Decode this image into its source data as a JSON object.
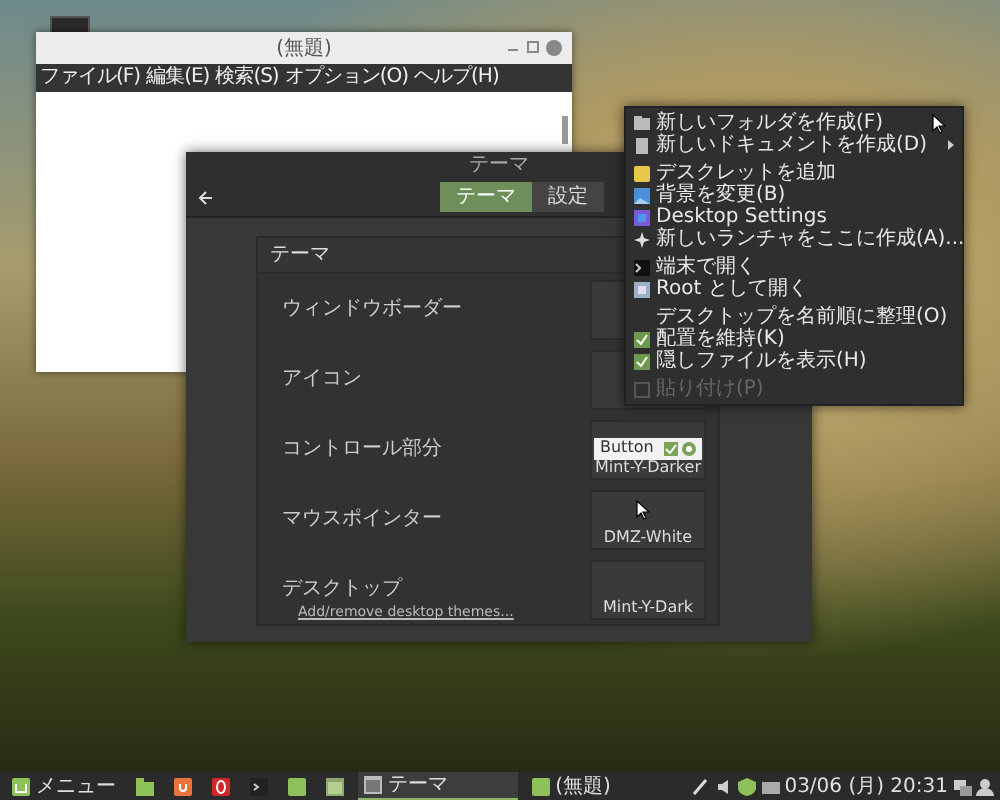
{
  "editor_window": {
    "title": "(無題)",
    "menu": [
      "ファイル(F)",
      "編集(E)",
      "検索(S)",
      "オプション(O)",
      "ヘルプ(H)"
    ]
  },
  "theme_window": {
    "title": "テーマ",
    "tabs": [
      {
        "label": "テーマ",
        "selected": true
      },
      {
        "label": "設定",
        "selected": false
      }
    ],
    "section_title": "テーマ",
    "rows": [
      {
        "label": "ウィンドウボーダー"
      },
      {
        "label": "アイコン"
      },
      {
        "label": "コントロール部分",
        "sample_button": "Button",
        "value": "Mint-Y-Darker"
      },
      {
        "label": "マウスポインター",
        "value": "DMZ-White"
      },
      {
        "label": "デスクトップ",
        "value": "Mint-Y-Dark",
        "link": "Add/remove desktop themes..."
      }
    ]
  },
  "context_menu": [
    [
      {
        "kind": "folder",
        "label": "新しいフォルダを作成(F)",
        "disabled": false
      },
      {
        "kind": "submenu",
        "label": "新しいドキュメントを作成(D)",
        "disabled": false
      }
    ],
    [
      {
        "kind": "desklet",
        "label": "デスクレットを追加",
        "disabled": false
      },
      {
        "kind": "background",
        "label": "背景を変更(B)",
        "disabled": false
      },
      {
        "kind": "settings",
        "label": "Desktop Settings",
        "disabled": false
      },
      {
        "kind": "launcher",
        "label": "新しいランチャをここに作成(A)...",
        "disabled": false
      }
    ],
    [
      {
        "kind": "terminal",
        "label": "端末で開く",
        "disabled": false
      },
      {
        "kind": "root",
        "label": "Root として開く",
        "disabled": false
      }
    ],
    [
      {
        "kind": "plain",
        "label": "デスクトップを名前順に整理(O)",
        "disabled": false
      },
      {
        "kind": "check",
        "label": "配置を維持(K)",
        "checked": true,
        "disabled": false
      },
      {
        "kind": "check",
        "label": "隠しファイルを表示(H)",
        "checked": true,
        "disabled": false
      }
    ],
    [
      {
        "kind": "paste",
        "label": "貼り付け(P)",
        "disabled": true
      }
    ]
  ],
  "taskbar": {
    "menu_label": "メニュー",
    "window_buttons": [
      {
        "label": "テーマ",
        "selected": true
      },
      {
        "label": "(無題)",
        "selected": false
      }
    ],
    "clock": "03/06 (月) 20:31"
  }
}
